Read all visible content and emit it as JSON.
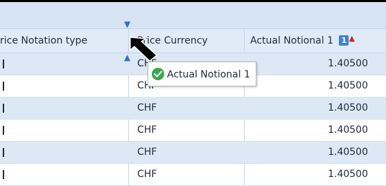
{
  "columns": [
    {
      "label": "rice Notation type"
    },
    {
      "label": "Price Currency"
    },
    {
      "label": "Actual Notional 1"
    }
  ],
  "sort": {
    "order": "1",
    "direction_glyph": "🠕"
  },
  "rows": [
    {
      "currency": "CHF",
      "notional": "1.40500"
    },
    {
      "currency": "CHF",
      "notional": "1.40500"
    },
    {
      "currency": "CHF",
      "notional": "1.40500"
    },
    {
      "currency": "CHF",
      "notional": "1.40500"
    },
    {
      "currency": "CHF",
      "notional": "1.40500"
    },
    {
      "currency": "CHF",
      "notional": "1.40500"
    }
  ],
  "drag_tooltip": {
    "label": "Actual Notional 1",
    "icon": "check-circle-icon"
  },
  "colors": {
    "header_bg": "#e1ebf8",
    "alt_row_bg": "#dde8f6",
    "accent": "#3b82d6",
    "ok_green": "#36a94a"
  }
}
